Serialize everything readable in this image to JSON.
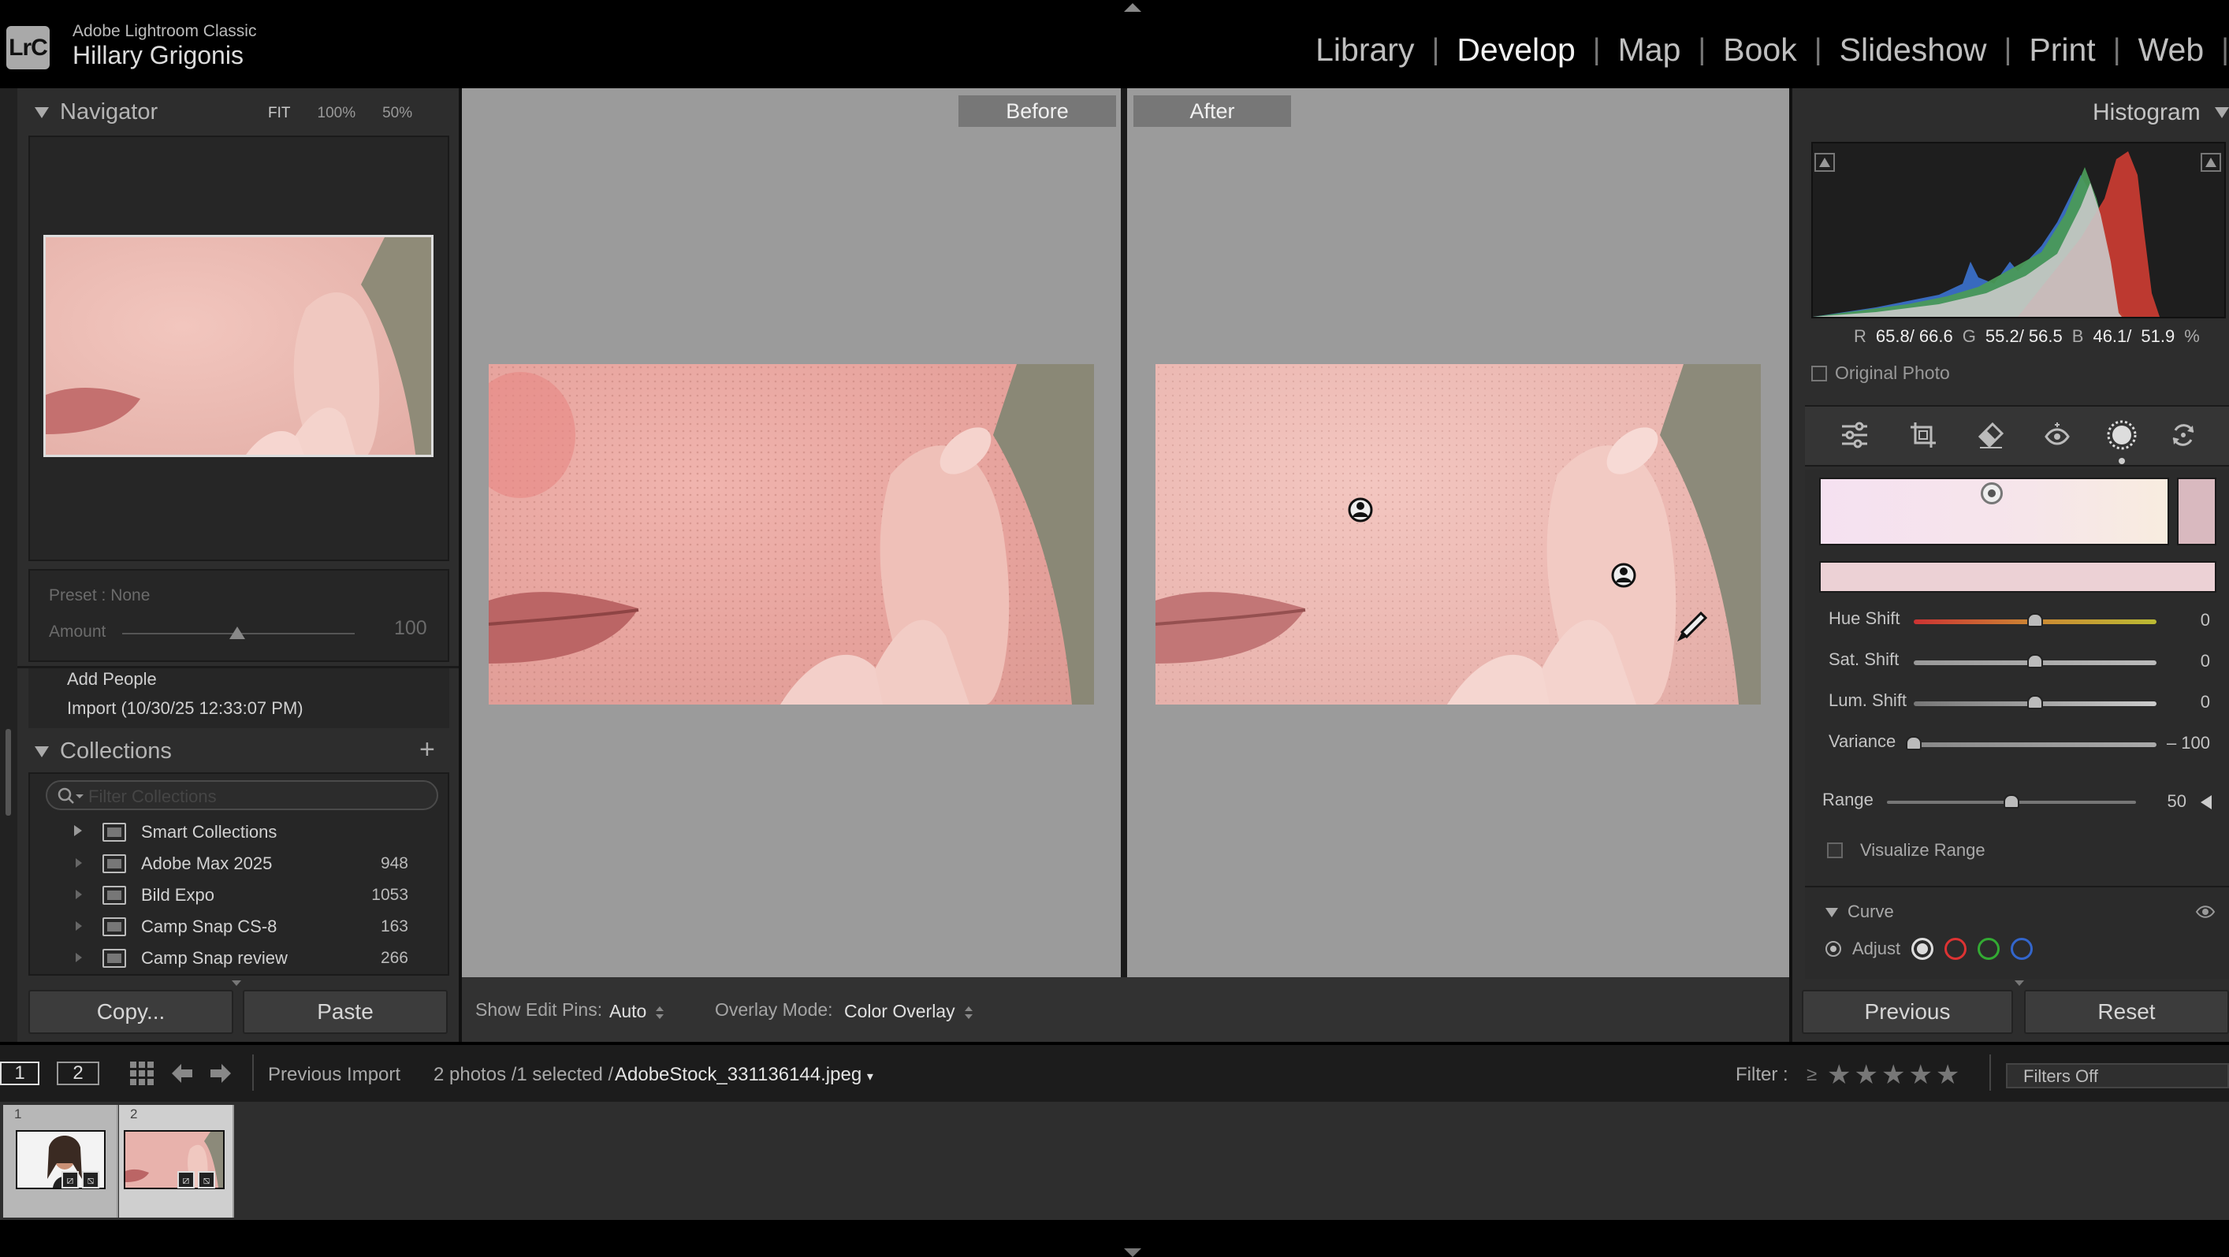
{
  "app": {
    "name": "Adobe Lightroom Classic",
    "logo": "LrC",
    "user": "Hillary Grigonis"
  },
  "modules": [
    {
      "label": "Library",
      "active": false
    },
    {
      "label": "Develop",
      "active": true
    },
    {
      "label": "Map",
      "active": false
    },
    {
      "label": "Book",
      "active": false
    },
    {
      "label": "Slideshow",
      "active": false
    },
    {
      "label": "Print",
      "active": false
    },
    {
      "label": "Web",
      "active": false
    }
  ],
  "navigator": {
    "title": "Navigator",
    "zoom": [
      "FIT",
      "100%",
      "50%"
    ]
  },
  "preset": {
    "label": "Preset : None",
    "amount_label": "Amount",
    "amount_value": "100"
  },
  "history": [
    "Add People",
    "Import (10/30/25 12:33:07 PM)"
  ],
  "collections": {
    "title": "Collections",
    "add": "+",
    "filter_placeholder": "Filter Collections",
    "items": [
      {
        "name": "Smart Collections",
        "count": ""
      },
      {
        "name": "Adobe Max 2025",
        "count": "948"
      },
      {
        "name": "Bild Expo",
        "count": "1053"
      },
      {
        "name": "Camp Snap CS-8",
        "count": "163"
      },
      {
        "name": "Camp Snap review",
        "count": "266"
      }
    ]
  },
  "left_buttons": {
    "copy": "Copy...",
    "paste": "Paste"
  },
  "view": {
    "before": "Before",
    "after": "After"
  },
  "toolbar": {
    "pins_label": "Show Edit Pins:",
    "pins_value": "Auto",
    "overlay_label": "Overlay Mode:",
    "overlay_value": "Color Overlay"
  },
  "histogram": {
    "title": "Histogram",
    "readout": {
      "r_label": "R",
      "r": "65.8/ 66.6",
      "g_label": "G",
      "g": "55.2/ 56.5",
      "b_label": "B",
      "b": "46.1/",
      "b2": "51.9",
      "unit": "%"
    },
    "original_photo": "Original Photo"
  },
  "tools": [
    "sliders-icon",
    "crop-icon",
    "eraser-icon",
    "redeye-icon",
    "masking-icon",
    "reset-tool-icon"
  ],
  "color_panel": {
    "sliders": [
      {
        "label": "Hue Shift",
        "value": "0",
        "pos": 0.5
      },
      {
        "label": "Sat. Shift",
        "value": "0",
        "pos": 0.5
      },
      {
        "label": "Lum. Shift",
        "value": "0",
        "pos": 0.5
      },
      {
        "label": "Variance",
        "value": "– 100",
        "pos": 0.0
      }
    ],
    "range": {
      "label": "Range",
      "value": "50",
      "pos": 0.5
    },
    "visualize": "Visualize Range"
  },
  "curve": {
    "title": "Curve",
    "adjust": "Adjust"
  },
  "right_buttons": {
    "previous": "Previous",
    "reset": "Reset"
  },
  "filmstrip_bar": {
    "pages": [
      "1",
      "2"
    ],
    "source": "Previous Import",
    "count": "2 photos /1 selected /",
    "filename": "AdobeStock_331136144.jpeg",
    "filter_label": "Filter :",
    "ge": "≥",
    "stars": "★★★★★",
    "filter_value": "Filters Off"
  },
  "filmstrip": [
    {
      "num": "1"
    },
    {
      "num": "2"
    }
  ]
}
